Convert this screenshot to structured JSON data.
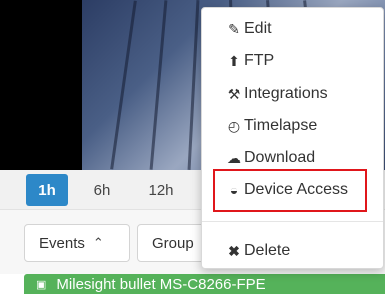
{
  "timeline": {
    "ranges": [
      {
        "label": "1h",
        "active": true
      },
      {
        "label": "6h",
        "active": false
      },
      {
        "label": "12h",
        "active": false
      }
    ]
  },
  "filters": {
    "events_label": "Events",
    "group_label": "Group"
  },
  "camera": {
    "name": "Milesight bullet MS-C8266-FPE"
  },
  "menu": {
    "items": [
      {
        "label": "Edit",
        "icon": "pencil-icon"
      },
      {
        "label": "FTP",
        "icon": "upload-icon"
      },
      {
        "label": "Integrations",
        "icon": "wrench-icon"
      },
      {
        "label": "Timelapse",
        "icon": "timelapse-icon"
      },
      {
        "label": "Download",
        "icon": "cloud-download-icon"
      },
      {
        "label": "Device Access",
        "icon": "globe-icon",
        "highlighted": true
      },
      {
        "label": "Delete",
        "icon": "close-icon"
      }
    ]
  },
  "colors": {
    "active_time": "#2d88c8",
    "camera_label_bg": "#55b25a",
    "highlight_border": "#e0161b"
  }
}
